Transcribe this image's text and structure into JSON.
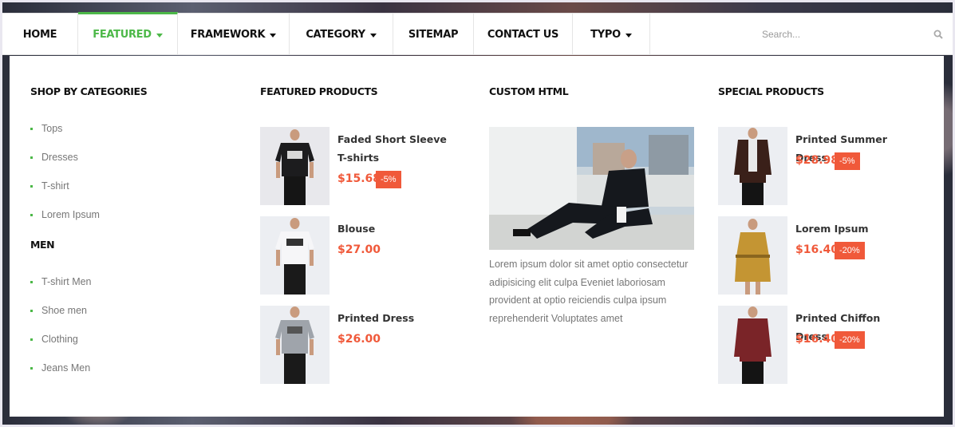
{
  "nav": {
    "items": [
      {
        "label": "HOME",
        "has_caret": false
      },
      {
        "label": "FEATURED",
        "has_caret": true,
        "active": true
      },
      {
        "label": "FRAMEWORK",
        "has_caret": true
      },
      {
        "label": "CATEGORY",
        "has_caret": true
      },
      {
        "label": "SITEMAP",
        "has_caret": false
      },
      {
        "label": "CONTACT US",
        "has_caret": false
      },
      {
        "label": "TYPO",
        "has_caret": true
      }
    ],
    "search_placeholder": "Search...",
    "accent": "#4cb848"
  },
  "shop_by_categories": {
    "title": "SHOP BY CATEGORIES",
    "items": [
      "Tops",
      "Dresses",
      "T-shirt",
      "Lorem Ipsum"
    ]
  },
  "men": {
    "title": "MEN",
    "items": [
      "T-shirt Men",
      "Shoe men",
      "Clothing",
      "Jeans Men"
    ]
  },
  "featured_products": {
    "title": "FEATURED PRODUCTS",
    "items": [
      {
        "name": "Faded Short Sleeve T-shirts",
        "price": "$15.68",
        "discount": "-5%"
      },
      {
        "name": "Blouse",
        "price": "$27.00",
        "discount": ""
      },
      {
        "name": "Printed Dress",
        "price": "$26.00",
        "discount": ""
      }
    ]
  },
  "custom_html": {
    "title": "CUSTOM HTML",
    "text": "Lorem ipsum dolor sit amet optio consectetur adipisicing elit culpa Eveniet laboriosam provident at optio reiciendis culpa ipsum reprehenderit Voluptates amet"
  },
  "special_products": {
    "title": "SPECIAL PRODUCTS",
    "items": [
      {
        "name": "Printed Summer Dress",
        "price": "$28.98",
        "discount": "-5%"
      },
      {
        "name": "Lorem Ipsum",
        "price": "$16.40",
        "discount": "-20%"
      },
      {
        "name": "Printed Chiffon Dress",
        "price": "$16.40",
        "discount": "-20%"
      }
    ]
  },
  "colors": {
    "price": "#f0593a",
    "bullet": "#4cb848"
  }
}
